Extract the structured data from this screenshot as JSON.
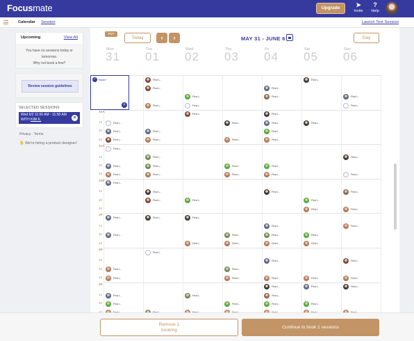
{
  "topbar": {
    "logo_bold": "Focus",
    "logo_light": "mate",
    "upgrade": "Upgrade",
    "invite": "Invite",
    "help": "Help"
  },
  "subnav": {
    "calendar": "Calendar",
    "session": "Session",
    "launch": "Launch Test Session"
  },
  "sidebar": {
    "upcoming": "Upcoming",
    "view_all": "View All",
    "no_sessions_line1": "You have no sessions today or tomorrow.",
    "no_sessions_line2": "Why not book a few?",
    "review": "Review session guidelines",
    "selected_header": "SELECTED SESSIONS",
    "selected_line1": "Wed 6/2 11:00 AM - 11:50 AM",
    "selected_line2_prefix": "WITH ",
    "selected_line2_name": "KIM K.",
    "privacy": "Privacy · Terms",
    "hiring": "We're hiring a product designer!"
  },
  "toolbar": {
    "pdf": "PDT",
    "today": "Today",
    "prev": "‹",
    "next": "›",
    "range": "MAY 31 - JUNE 6",
    "day": "Day"
  },
  "days": [
    {
      "name": "Mon",
      "date": "31"
    },
    {
      "name": "Tue",
      "date": "01"
    },
    {
      "name": "Wed",
      "date": "02"
    },
    {
      "name": "Thu",
      "date": "03"
    },
    {
      "name": "Fri",
      "date": "04"
    },
    {
      "name": "Sat",
      "date": "05"
    },
    {
      "name": "Sun",
      "date": "06"
    }
  ],
  "time_labels": [
    {
      "h": "9A",
      "subs": [
        "15",
        "30",
        "45"
      ]
    },
    {
      "h": "10A",
      "subs": [
        "15",
        "30",
        "45"
      ]
    },
    {
      "h": "11A",
      "subs": [
        "15",
        "30",
        "45"
      ]
    },
    {
      "h": "12P",
      "subs": [
        "15",
        "30",
        "45"
      ]
    },
    {
      "h": "1P",
      "subs": [
        "15",
        "30",
        "45"
      ]
    },
    {
      "h": "2P",
      "subs": [
        "15",
        "30",
        "45"
      ]
    },
    {
      "h": "3P",
      "subs": [
        "15",
        "30",
        "45"
      ]
    }
  ],
  "slot_name": "First L.",
  "book_label": "Book?",
  "booked_slot": {
    "day": 2,
    "row": 8
  },
  "colors": {
    "brand": "#363a9f",
    "accent": "#c29466",
    "avatar_palette": [
      "#8a6a55",
      "#4cae3a",
      "#7d4a3a",
      "#5b6a8a",
      "#b07b5e",
      "#3c3c3c",
      "#6c8e5a"
    ]
  },
  "slots": [
    {
      "d": 0,
      "r": 0,
      "c": 4
    },
    {
      "d": 0,
      "r": 3,
      "c": 2
    },
    {
      "d": 1,
      "r": 0,
      "c": 2
    },
    {
      "d": 1,
      "r": 1,
      "c": 2
    },
    {
      "d": 1,
      "r": 3,
      "c": 4
    },
    {
      "d": 2,
      "r": 2,
      "c": 1
    },
    {
      "d": 2,
      "r": 3,
      "c": "e"
    },
    {
      "d": 4,
      "r": 1,
      "c": 3
    },
    {
      "d": 4,
      "r": 2,
      "c": 0
    },
    {
      "d": 5,
      "r": 0,
      "c": 5
    },
    {
      "d": 6,
      "r": 2,
      "c": 3
    },
    {
      "d": 6,
      "r": 3,
      "c": "e"
    },
    {
      "d": 0,
      "r": 5,
      "c": "e"
    },
    {
      "d": 0,
      "r": 6,
      "c": 3
    },
    {
      "d": 0,
      "r": 7,
      "c": 2
    },
    {
      "d": 1,
      "r": 6,
      "c": 3
    },
    {
      "d": 1,
      "r": 7,
      "c": 4
    },
    {
      "d": 2,
      "r": 4,
      "c": 2
    },
    {
      "d": 3,
      "r": 5,
      "c": 5
    },
    {
      "d": 3,
      "r": 7,
      "c": 4
    },
    {
      "d": 4,
      "r": 4,
      "c": 5
    },
    {
      "d": 4,
      "r": 5,
      "c": 3
    },
    {
      "d": 4,
      "r": 6,
      "c": 1
    },
    {
      "d": 4,
      "r": 7,
      "c": 4
    },
    {
      "d": 5,
      "r": 5,
      "c": 5
    },
    {
      "d": 0,
      "r": 8,
      "c": "e"
    },
    {
      "d": 0,
      "r": 10,
      "c": 3
    },
    {
      "d": 0,
      "r": 11,
      "c": 4
    },
    {
      "d": 1,
      "r": 9,
      "c": 6
    },
    {
      "d": 1,
      "r": 10,
      "c": 6
    },
    {
      "d": 1,
      "r": 11,
      "c": 4
    },
    {
      "d": 3,
      "r": 10,
      "c": 1
    },
    {
      "d": 3,
      "r": 11,
      "c": 4
    },
    {
      "d": 4,
      "r": 10,
      "c": 1
    },
    {
      "d": 4,
      "r": 11,
      "c": 4
    },
    {
      "d": 6,
      "r": 9,
      "c": 5
    },
    {
      "d": 6,
      "r": 11,
      "c": "e"
    },
    {
      "d": 0,
      "r": 12,
      "c": 3
    },
    {
      "d": 1,
      "r": 13,
      "c": 5
    },
    {
      "d": 1,
      "r": 14,
      "c": 2
    },
    {
      "d": 2,
      "r": 14,
      "c": 1
    },
    {
      "d": 4,
      "r": 13,
      "c": 5
    },
    {
      "d": 5,
      "r": 14,
      "c": 1
    },
    {
      "d": 5,
      "r": 15,
      "c": 4
    },
    {
      "d": 6,
      "r": 13,
      "c": 0
    },
    {
      "d": 6,
      "r": 15,
      "c": 4
    },
    {
      "d": 0,
      "r": 16,
      "c": 3
    },
    {
      "d": 1,
      "r": 16,
      "c": 5
    },
    {
      "d": 2,
      "r": 16,
      "c": 5
    },
    {
      "d": 0,
      "r": 18,
      "c": 3
    },
    {
      "d": 2,
      "r": 19,
      "c": 4
    },
    {
      "d": 3,
      "r": 18,
      "c": 6
    },
    {
      "d": 3,
      "r": 19,
      "c": 4
    },
    {
      "d": 4,
      "r": 17,
      "c": 3
    },
    {
      "d": 4,
      "r": 18,
      "c": 6
    },
    {
      "d": 4,
      "r": 19,
      "c": 4
    },
    {
      "d": 5,
      "r": 18,
      "c": 1
    },
    {
      "d": 5,
      "r": 19,
      "c": 4
    },
    {
      "d": 6,
      "r": 17,
      "c": 4
    },
    {
      "d": 1,
      "r": 20,
      "c": "e"
    },
    {
      "d": 0,
      "r": 22,
      "c": 4
    },
    {
      "d": 0,
      "r": 23,
      "c": 4
    },
    {
      "d": 3,
      "r": 22,
      "c": 6
    },
    {
      "d": 3,
      "r": 23,
      "c": 4
    },
    {
      "d": 4,
      "r": 21,
      "c": 3
    },
    {
      "d": 4,
      "r": 23,
      "c": 4
    },
    {
      "d": 5,
      "r": 23,
      "c": 4
    },
    {
      "d": 6,
      "r": 21,
      "c": 2
    },
    {
      "d": 6,
      "r": 23,
      "c": 4
    },
    {
      "d": 0,
      "r": 25,
      "c": 3
    },
    {
      "d": 0,
      "r": 26,
      "c": 1
    },
    {
      "d": 0,
      "r": 27,
      "c": 4
    },
    {
      "d": 1,
      "r": 27,
      "c": 6
    },
    {
      "d": 2,
      "r": 25,
      "c": 6
    },
    {
      "d": 2,
      "r": 27,
      "c": 4
    },
    {
      "d": 3,
      "r": 26,
      "c": 1
    },
    {
      "d": 3,
      "r": 27,
      "c": 4
    },
    {
      "d": 4,
      "r": 24,
      "c": 5
    },
    {
      "d": 4,
      "r": 25,
      "c": 0
    },
    {
      "d": 4,
      "r": 26,
      "c": 1
    },
    {
      "d": 4,
      "r": 27,
      "c": 4
    },
    {
      "d": 5,
      "r": 24,
      "c": 3
    },
    {
      "d": 5,
      "r": 26,
      "c": 1
    },
    {
      "d": 5,
      "r": 27,
      "c": 4
    },
    {
      "d": 6,
      "r": 24,
      "c": 5
    },
    {
      "d": 6,
      "r": 27,
      "c": 4
    }
  ],
  "bottom": {
    "remove_line1": "Remove 1",
    "remove_line2": "booking",
    "continue": "Continue to book 1 sessions"
  }
}
